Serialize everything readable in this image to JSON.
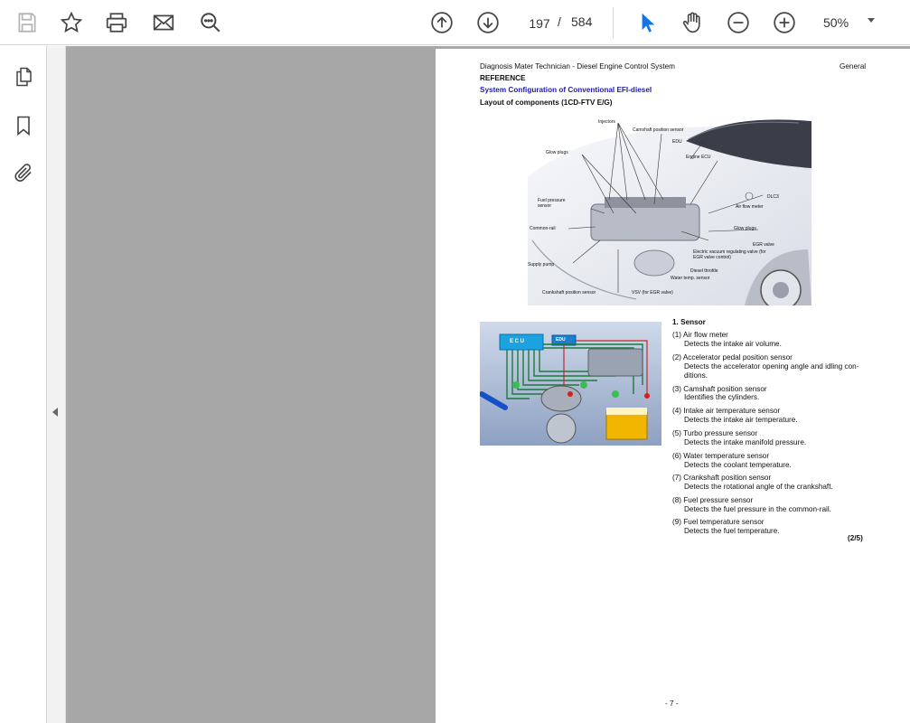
{
  "toolbar": {
    "page_current": "197",
    "page_separator": "/",
    "page_total": "584",
    "zoom": "50%"
  },
  "document": {
    "header_left": "Diagnosis Mater Technician - Diesel Engine Control System",
    "header_right": "General",
    "reference": "REFERENCE",
    "section_title": "System Configuration of Conventional EFI-diesel",
    "layout_title": "Layout of components (1CD-FTV E/G)",
    "diagram_labels": [
      "Injectors",
      "Camshaft position sensor",
      "EDU",
      "Engine ECU",
      "Glow plugs",
      "DLC3",
      "Fuel pressure sensor",
      "Air flow meter",
      "Common-rail",
      "Glow plugs",
      "EGR valve",
      "Electric vacuum regulating valve (for EGR valve control)",
      "Diesel throttle",
      "Water temp. sensor",
      "Supply pump",
      "Crankshaft position sensor",
      "VSV (for EGR valve)"
    ],
    "ecu_label": "E C U",
    "edu_label": "EDU",
    "sensor_heading": "1.  Sensor",
    "sensors": [
      {
        "name": "(1) Air flow meter",
        "desc": "Detects the intake air volume."
      },
      {
        "name": "(2) Accelerator pedal position sensor",
        "desc": "Detects the accelerator opening angle and idling con-",
        "desc2": "ditions."
      },
      {
        "name": "(3) Camshaft position sensor",
        "desc": "Identifies the cylinders."
      },
      {
        "name": "(4) Intake air temperature sensor",
        "desc": "Detects the intake air temperature."
      },
      {
        "name": "(5) Turbo pressure sensor",
        "desc": "Detects the intake manifold pressure."
      },
      {
        "name": "(6) Water temperature sensor",
        "desc": "Detects the coolant temperature."
      },
      {
        "name": "(7) Crankshaft position sensor",
        "desc": "Detects the rotational angle of the crankshaft."
      },
      {
        "name": "(8) Fuel pressure sensor",
        "desc": "Detects the fuel pressure in the common-rail."
      },
      {
        "name": "(9) Fuel temperature sensor",
        "desc": "Detects the fuel temperature."
      }
    ],
    "page_indicator": "(2/5)",
    "footer": "- 7 -"
  },
  "colors": {
    "accent": "#1473e6",
    "viewer_bg": "#a7a7a7",
    "section_title": "#1b1bb3"
  }
}
